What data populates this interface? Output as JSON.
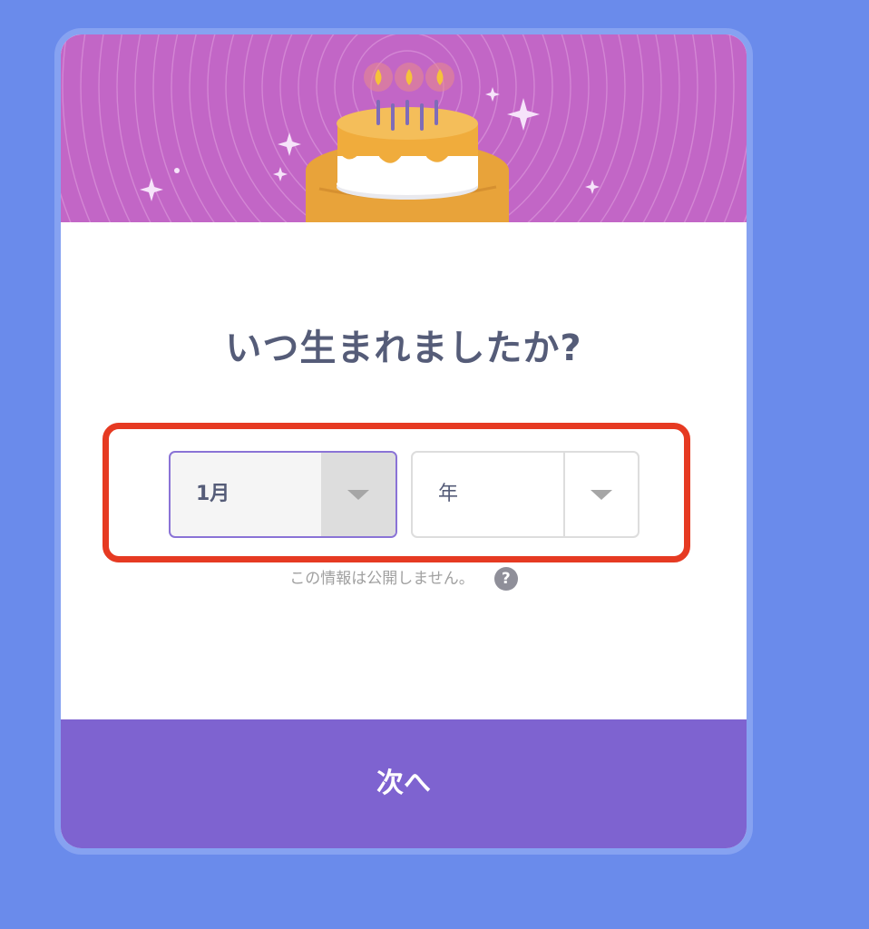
{
  "dialog": {
    "title": "いつ生まれましたか?",
    "month_select": {
      "selected": "1月"
    },
    "year_select": {
      "selected": "年"
    },
    "privacy_text": "この情報は公開しません。",
    "help_icon_glyph": "?",
    "next_label": "次へ"
  },
  "colors": {
    "page_background": "#6A8BEB",
    "hero_background": "#C266C6",
    "cake": "#F0AC3C",
    "button": "#7E63D0",
    "highlight": "#E63A22",
    "title_text": "#555C78"
  },
  "icons": {
    "hero": "birthday-cake-illustration",
    "dropdown": "chevron-down-icon",
    "help": "question-icon"
  }
}
